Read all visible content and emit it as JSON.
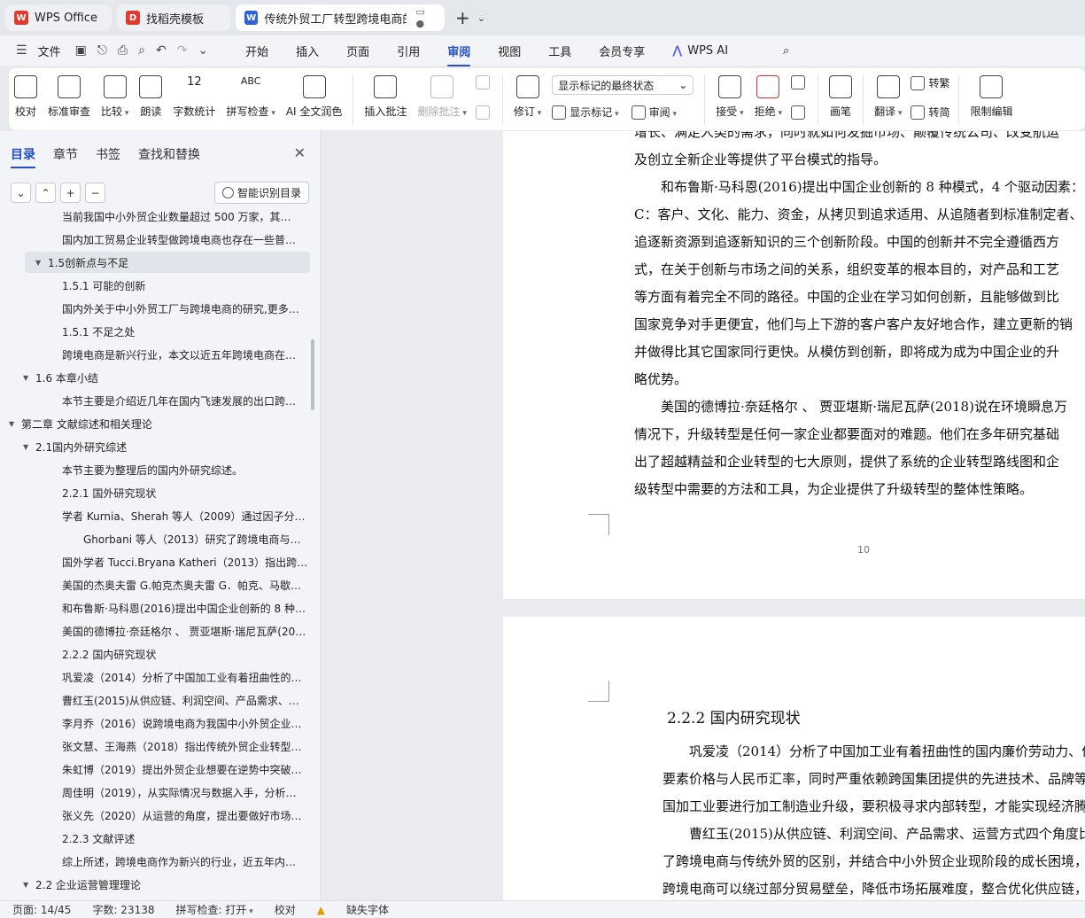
{
  "tabs": [
    {
      "label": "WPS Office",
      "logo": "W",
      "logo_color": "#e03b2e"
    },
    {
      "label": "找稻壳模板",
      "logo": "D",
      "logo_color": "#e03b2e"
    },
    {
      "label": "传统外贸工厂转型跨境电商的",
      "logo": "W",
      "logo_color": "#2d62d8"
    }
  ],
  "menu": {
    "file": "文件",
    "tabs": [
      "开始",
      "插入",
      "页面",
      "引用",
      "审阅",
      "视图",
      "工具",
      "会员专享"
    ],
    "active": "审阅",
    "wps_ai": "WPS AI"
  },
  "ribbon": {
    "proofread": "校对",
    "standard_review": "标准审查",
    "compare": "比较",
    "read_aloud": "朗读",
    "word_count": "字数统计",
    "spell_check": "拼写检查",
    "ai_polish": "AI 全文润色",
    "insert_comment": "插入批注",
    "delete_comment": "删除批注",
    "track_changes": "修订",
    "markup_select": "显示标记的最终状态",
    "show_markup": "显示标记",
    "review": "审阅",
    "accept": "接受",
    "reject": "拒绝",
    "pen": "画笔",
    "translate": "翻译",
    "to_traditional": "转繁",
    "to_simplified": "转简",
    "restrict_edit": "限制编辑",
    "icon_wordcount": "12",
    "icon_spell": "ABC"
  },
  "leftpanel": {
    "tabs": [
      "目录",
      "章节",
      "书签",
      "查找和替换"
    ],
    "active_tab": "目录",
    "smart_button": "智能识别目录",
    "toc": [
      {
        "text": "当前我国中小外贸企业数量超过 500 万家，其…",
        "indent": 3,
        "arrow": ""
      },
      {
        "text": "国内加工贸易企业转型做跨境电商也存在一些普…",
        "indent": 3,
        "arrow": ""
      },
      {
        "text": "1.5创新点与不足",
        "indent": 2,
        "arrow": "▼",
        "selected": true
      },
      {
        "text": "1.5.1  可能的创新",
        "indent": 3,
        "arrow": ""
      },
      {
        "text": "国内外关于中小外贸工厂与跨境电商的研究,更多…",
        "indent": 3,
        "arrow": ""
      },
      {
        "text": "1.5.1  不足之处",
        "indent": 3,
        "arrow": ""
      },
      {
        "text": "跨境电商是新兴行业，本文以近五年跨境电商在…",
        "indent": 3,
        "arrow": ""
      },
      {
        "text": "1.6  本章小结",
        "indent": 2,
        "arrow": "▼"
      },
      {
        "text": "本节主要是介绍近几年在国内飞速发展的出口跨…",
        "indent": 3,
        "arrow": ""
      },
      {
        "text": "第二章  文献综述和相关理论",
        "indent": 1,
        "arrow": "▼"
      },
      {
        "text": "2.1国内外研究综述",
        "indent": 2,
        "arrow": "▼"
      },
      {
        "text": "本节主要为整理后的国内外研究综述。",
        "indent": 3,
        "arrow": ""
      },
      {
        "text": "2.2.1 国外研究现状",
        "indent": 3,
        "arrow": ""
      },
      {
        "text": "学者 Kurnia、Sherah 等人（2009）通过因子分…",
        "indent": 3,
        "arrow": ""
      },
      {
        "text": "Ghorbani 等人（2013）研究了跨境电商与…",
        "indent": 4,
        "arrow": ""
      },
      {
        "text": "国外学者 Tucci.Bryana Katheri（2013）指出跨…",
        "indent": 3,
        "arrow": ""
      },
      {
        "text": "美国的杰奥夫雷 G.帕克杰奥夫雷 G．帕克、马歇…",
        "indent": 3,
        "arrow": ""
      },
      {
        "text": "和布鲁斯·马科恩(2016)提出中国企业创新的 8 种…",
        "indent": 3,
        "arrow": ""
      },
      {
        "text": "美国的德博拉·奈廷格尔 、 贾亚堪斯·瑞尼瓦萨(20…",
        "indent": 3,
        "arrow": ""
      },
      {
        "text": "2.2.2 国内研究现状",
        "indent": 3,
        "arrow": ""
      },
      {
        "text": "巩爱凌（2014）分析了中国加工业有着扭曲性的…",
        "indent": 3,
        "arrow": ""
      },
      {
        "text": "曹红玉(2015)从供应链、利润空间、产品需求、…",
        "indent": 3,
        "arrow": ""
      },
      {
        "text": "李月乔（2016）说跨境电商为我国中小外贸企业…",
        "indent": 3,
        "arrow": ""
      },
      {
        "text": "张文慧、王海燕（2018）指出传统外贸企业转型…",
        "indent": 3,
        "arrow": ""
      },
      {
        "text": "朱虹博（2019）提出外贸企业想要在逆势中突破…",
        "indent": 3,
        "arrow": ""
      },
      {
        "text": "周佳明（2019），从实际情况与数据入手，分析…",
        "indent": 3,
        "arrow": ""
      },
      {
        "text": "张义先（2020）从运营的角度，提出要做好市场…",
        "indent": 3,
        "arrow": ""
      },
      {
        "text": "2.2.3 文献评述",
        "indent": 3,
        "arrow": ""
      },
      {
        "text": "综上所述，跨境电商作为新兴的行业，近五年内…",
        "indent": 3,
        "arrow": ""
      },
      {
        "text": "2.2  企业运营管理理论",
        "indent": 2,
        "arrow": "▼"
      }
    ]
  },
  "document": {
    "page1_lines": [
      "增长、满足人类的需求，同时就如何发掘市场、颠覆传统公司、改变航运",
      "及创立全新企业等提供了平台模式的指导。",
      "　　和布鲁斯·马科恩(2016)提出中国企业创新的 8 种模式，4 个驱动因素：",
      "C：客户、文化、能力、资金，从拷贝到追求适用、从追随者到标准制定者、",
      "追逐新资源到追逐新知识的三个创新阶段。中国的创新并不完全遵循西方",
      "式，在关于创新与市场之间的关系，组织变革的根本目的，对产品和工艺",
      "等方面有着完全不同的路径。中国的企业在学习如何创新，且能够做到比",
      "国家竞争对手更便宜，他们与上下游的客户客户友好地合作，建立更新的销",
      "并做得比其它国家同行更快。从模仿到创新，即将成为成为中国企业的升",
      "略优势。",
      "　　美国的德博拉·奈廷格尔 、 贾亚堪斯·瑞尼瓦萨(2018)说在环境瞬息万",
      "情况下，升级转型是任何一家企业都要面对的难题。他们在多年研究基础",
      "出了超越精益和企业转型的七大原则，提供了系统的企业转型路线图和企",
      "级转型中需要的方法和工具，为企业提供了升级转型的整体性策略。"
    ],
    "page_number": "10",
    "heading": "2.2.2 国内研究现状",
    "page2_lines": [
      "　　巩爱凌（2014）分析了中国加工业有着扭曲性的国内廉价劳动力、价",
      "要素价格与人民币汇率，同时严重依赖跨国集团提供的先进技术、品牌等",
      "国加工业要进行加工制造业升级，要积极寻求内部转型，才能实现经济腾",
      "　　曹红玉(2015)从供应链、利润空间、产品需求、运营方式四个角度比较",
      "了跨境电商与传统外贸的区别，并结合中小外贸企业现阶段的成长困境，",
      "跨境电商可以绕过部分贸易壁垒，降低市场拓展难度，整合优化供应链，"
    ]
  },
  "status": {
    "page": "页面: 14/45",
    "words": "字数: 23138",
    "spell": "拼写检查: 打开",
    "proof": "校对",
    "missing_font": "缺失字体"
  }
}
